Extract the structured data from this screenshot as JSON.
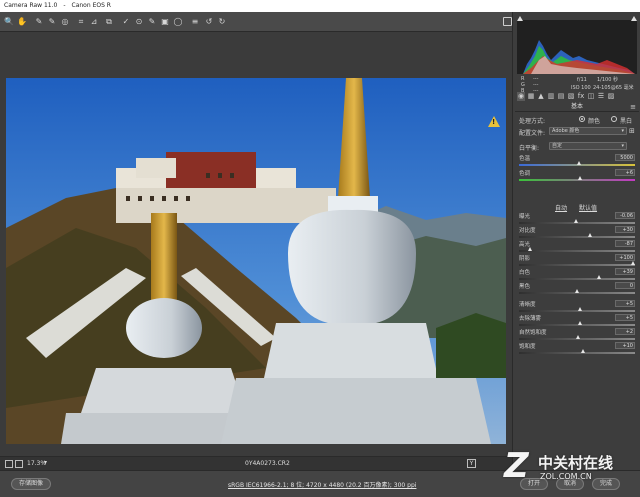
{
  "window": {
    "title_app": "Camera Raw 11.0",
    "title_camera": "Canon EOS R"
  },
  "toolbar": {
    "tools": [
      {
        "icon": "zoom-icon",
        "glyph": "🔍"
      },
      {
        "icon": "hand-icon",
        "glyph": "✋"
      },
      {
        "icon": "white-balance-icon",
        "glyph": "✎"
      },
      {
        "icon": "color-sampler-icon",
        "glyph": "✎"
      },
      {
        "icon": "target-adjust-icon",
        "glyph": "◎"
      },
      {
        "icon": "crop-icon",
        "glyph": "⌗"
      },
      {
        "icon": "straighten-icon",
        "glyph": "⊿"
      },
      {
        "icon": "transform-icon",
        "glyph": "⧉"
      },
      {
        "icon": "spot-removal-icon",
        "glyph": "✓"
      },
      {
        "icon": "red-eye-icon",
        "glyph": "⊙"
      },
      {
        "icon": "brush-icon",
        "glyph": "✎"
      },
      {
        "icon": "graduated-filter-icon",
        "glyph": "▣"
      },
      {
        "icon": "radial-filter-icon",
        "glyph": "◯"
      },
      {
        "icon": "preferences-icon",
        "glyph": "≡"
      },
      {
        "icon": "rotate-left-icon",
        "glyph": "↺"
      },
      {
        "icon": "rotate-right-icon",
        "glyph": "↻"
      }
    ]
  },
  "histogram_readout": {
    "r_label": "R",
    "r_value": "---",
    "g_label": "G",
    "g_value": "---",
    "b_label": "B",
    "b_value": "---",
    "aperture": "f/11",
    "shutter": "1/100 秒",
    "iso": "ISO 100",
    "lens": "24-105@65 毫米"
  },
  "panel": {
    "section_title": "基本",
    "treatment_label": "处理方式:",
    "treatment_color": "颜色",
    "treatment_bw": "黑白",
    "profile_label": "配置文件:",
    "profile_value": "Adobe 颜色",
    "wb_label": "白平衡:",
    "wb_value": "自定",
    "auto_label": "自动",
    "default_label": "默认值"
  },
  "sliders": [
    {
      "label": "色温",
      "value": "5000",
      "level": 0.52
    },
    {
      "label": "色调",
      "value": "+6",
      "level": 0.53
    },
    {
      "label": "曝光",
      "value": "-0.06",
      "level": 0.49
    },
    {
      "label": "对比度",
      "value": "+30",
      "level": 0.62
    },
    {
      "label": "高光",
      "value": "-87",
      "level": 0.08
    },
    {
      "label": "阴影",
      "value": "+100",
      "level": 1.0
    },
    {
      "label": "白色",
      "value": "+39",
      "level": 0.7
    },
    {
      "label": "黑色",
      "value": "0",
      "level": 0.5
    },
    {
      "label": "清晰度",
      "value": "+5",
      "level": 0.53
    },
    {
      "label": "去除薄雾",
      "value": "+5",
      "level": 0.53
    },
    {
      "label": "自然饱和度",
      "value": "+2",
      "level": 0.51
    },
    {
      "label": "饱和度",
      "value": "+10",
      "level": 0.55
    }
  ],
  "status": {
    "zoom": "17.3%",
    "filename": "0Y4A0273.CR2",
    "y_label": "Y"
  },
  "bottom": {
    "save_label": "存储图像",
    "workflow": "sRGB IEC61966-2.1; 8 位; 4720 x 4480 (20.2 百万像素); 300 ppi",
    "open_label": "打开",
    "cancel_label": "取消",
    "done_label": "完成"
  },
  "watermark": {
    "cn": "中关村在线",
    "url": "ZOL.COM.CN"
  },
  "colors": {
    "accent_warning": "#e8c23a",
    "panel_bg": "#3d3d3d"
  }
}
